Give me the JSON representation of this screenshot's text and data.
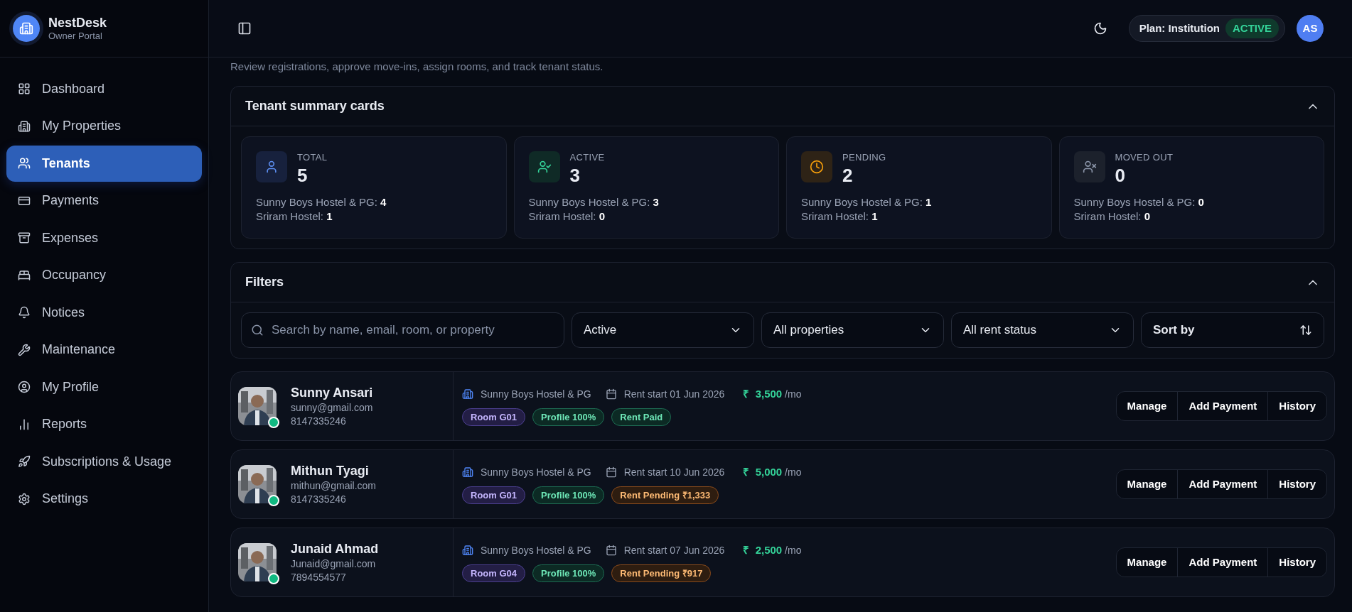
{
  "brand": {
    "name": "NestDesk",
    "subtitle": "Owner Portal"
  },
  "sidebar": {
    "items": [
      {
        "label": "Dashboard",
        "selected": false
      },
      {
        "label": "My Properties",
        "selected": false
      },
      {
        "label": "Tenants",
        "selected": true
      },
      {
        "label": "Payments",
        "selected": false
      },
      {
        "label": "Expenses",
        "selected": false
      },
      {
        "label": "Occupancy",
        "selected": false
      },
      {
        "label": "Notices",
        "selected": false
      },
      {
        "label": "Maintenance",
        "selected": false
      },
      {
        "label": "My Profile",
        "selected": false
      },
      {
        "label": "Reports",
        "selected": false
      },
      {
        "label": "Subscriptions & Usage",
        "selected": false
      },
      {
        "label": "Settings",
        "selected": false
      }
    ]
  },
  "header": {
    "plan": "Plan: Institution",
    "plan_status": "ACTIVE",
    "avatar": "AS"
  },
  "page_subtitle": "Review registrations, approve move-ins, assign rooms, and track tenant status.",
  "summary": {
    "title": "Tenant summary cards",
    "expanded": true,
    "cards": [
      {
        "kind": "total",
        "label": "TOTAL",
        "value": "5",
        "breakdown": [
          {
            "property": "Sunny Boys Hostel & PG:",
            "count": "4"
          },
          {
            "property": "Sriram Hostel:",
            "count": "1"
          }
        ]
      },
      {
        "kind": "active",
        "label": "ACTIVE",
        "value": "3",
        "breakdown": [
          {
            "property": "Sunny Boys Hostel & PG:",
            "count": "3"
          },
          {
            "property": "Sriram Hostel:",
            "count": "0"
          }
        ]
      },
      {
        "kind": "pending",
        "label": "PENDING",
        "value": "2",
        "breakdown": [
          {
            "property": "Sunny Boys Hostel & PG:",
            "count": "1"
          },
          {
            "property": "Sriram Hostel:",
            "count": "1"
          }
        ]
      },
      {
        "kind": "moved_out",
        "label": "MOVED OUT",
        "value": "0",
        "breakdown": [
          {
            "property": "Sunny Boys Hostel & PG:",
            "count": "0"
          },
          {
            "property": "Sriram Hostel:",
            "count": "0"
          }
        ]
      }
    ]
  },
  "filters": {
    "title": "Filters",
    "expanded": true,
    "search": {
      "placeholder": "Search by name, email, room, or property"
    },
    "selects": [
      "Active",
      "All properties",
      "All rent status"
    ],
    "sort": "Sort by"
  },
  "tenants": [
    {
      "name": "Sunny Ansari",
      "email": "sunny@gmail.com",
      "phone": "8147335246",
      "online": true,
      "property": "Sunny Boys Hostel & PG",
      "rent_start": "Rent start 01 Jun 2026",
      "currency": "₹",
      "rent": "3,500",
      "period": "/mo",
      "tags": [
        {
          "kind": "room",
          "text": "Room G01"
        },
        {
          "kind": "profile",
          "text": "Profile 100%"
        },
        {
          "kind": "paid",
          "text": "Rent Paid"
        }
      ],
      "actions": [
        "Manage",
        "Add Payment",
        "History"
      ]
    },
    {
      "name": "Mithun Tyagi",
      "email": "mithun@gmail.com",
      "phone": "8147335246",
      "online": true,
      "property": "Sunny Boys Hostel & PG",
      "rent_start": "Rent start 10 Jun 2026",
      "currency": "₹",
      "rent": "5,000",
      "period": "/mo",
      "tags": [
        {
          "kind": "room",
          "text": "Room G01"
        },
        {
          "kind": "profile",
          "text": "Profile 100%"
        },
        {
          "kind": "pending",
          "text": "Rent Pending ₹1,333"
        }
      ],
      "actions": [
        "Manage",
        "Add Payment",
        "History"
      ]
    },
    {
      "name": "Junaid Ahmad",
      "email": "Junaid@gmail.com",
      "phone": "7894554577",
      "online": true,
      "property": "Sunny Boys Hostel & PG",
      "rent_start": "Rent start 07 Jun 2026",
      "currency": "₹",
      "rent": "2,500",
      "period": "/mo",
      "tags": [
        {
          "kind": "room",
          "text": "Room G04"
        },
        {
          "kind": "profile",
          "text": "Profile 100%"
        },
        {
          "kind": "pending",
          "text": "Rent Pending ₹917"
        }
      ],
      "actions": [
        "Manage",
        "Add Payment",
        "History"
      ]
    }
  ]
}
